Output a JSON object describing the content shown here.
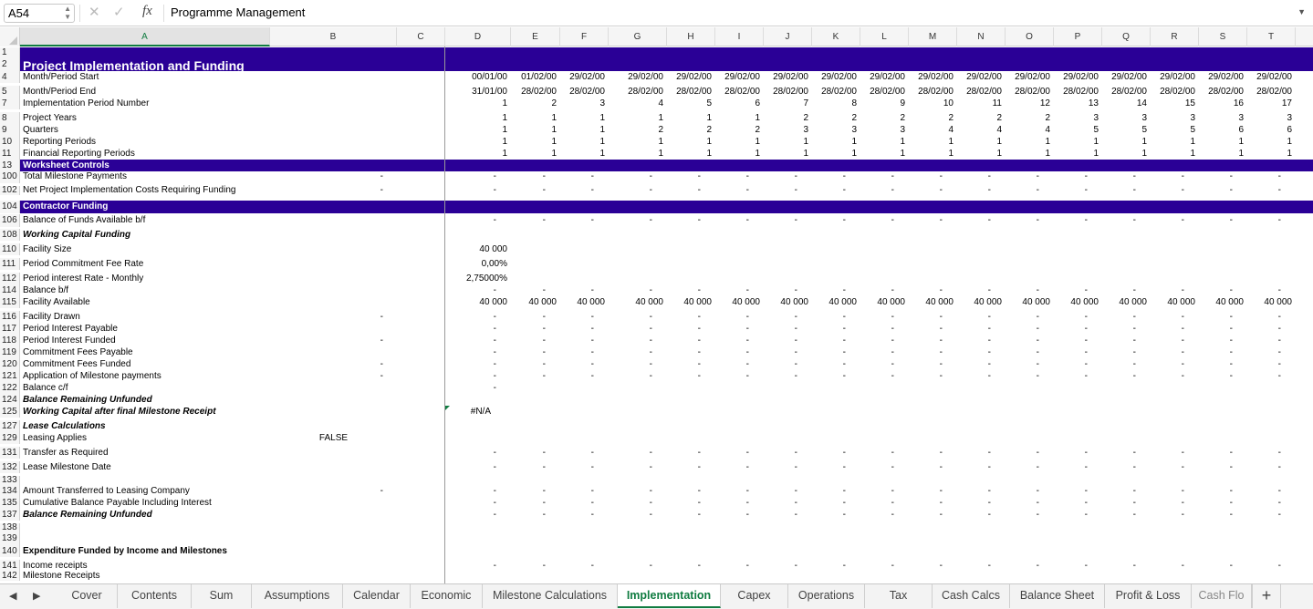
{
  "formula_bar": {
    "name_box": "A54",
    "fx_label": "fx",
    "formula": "Programme Management"
  },
  "columns": [
    "A",
    "B",
    "C",
    "D",
    "E",
    "F",
    "G",
    "H",
    "I",
    "J",
    "K",
    "L",
    "M",
    "N",
    "O",
    "P",
    "Q",
    "R",
    "S",
    "T"
  ],
  "rows": [
    {
      "n": "1",
      "type": "band",
      "label": ""
    },
    {
      "n": "2",
      "type": "band",
      "label": "Project Implementation and Funding",
      "big": true
    },
    {
      "n": "4",
      "label": "Month/Period Start",
      "vals": [
        "00/01/00",
        "01/02/00",
        "29/02/00",
        "29/02/00",
        "29/02/00",
        "29/02/00",
        "29/02/00",
        "29/02/00",
        "29/02/00",
        "29/02/00",
        "29/02/00",
        "29/02/00",
        "29/02/00",
        "29/02/00",
        "29/02/00",
        "29/02/00",
        "29/02/00"
      ]
    },
    {
      "n": "5",
      "label": "Month/Period End",
      "vals": [
        "31/01/00",
        "28/02/00",
        "28/02/00",
        "28/02/00",
        "28/02/00",
        "28/02/00",
        "28/02/00",
        "28/02/00",
        "28/02/00",
        "28/02/00",
        "28/02/00",
        "28/02/00",
        "28/02/00",
        "28/02/00",
        "28/02/00",
        "28/02/00",
        "28/02/00"
      ]
    },
    {
      "n": "7",
      "label": "Implementation Period Number",
      "vals": [
        "1",
        "2",
        "3",
        "4",
        "5",
        "6",
        "7",
        "8",
        "9",
        "10",
        "11",
        "12",
        "13",
        "14",
        "15",
        "16",
        "17"
      ]
    },
    {
      "n": "8",
      "label": "Project Years",
      "vals": [
        "1",
        "1",
        "1",
        "1",
        "1",
        "1",
        "2",
        "2",
        "2",
        "2",
        "2",
        "2",
        "3",
        "3",
        "3",
        "3",
        "3"
      ]
    },
    {
      "n": "9",
      "label": "Quarters",
      "vals": [
        "1",
        "1",
        "1",
        "2",
        "2",
        "2",
        "3",
        "3",
        "3",
        "4",
        "4",
        "4",
        "5",
        "5",
        "5",
        "6",
        "6"
      ]
    },
    {
      "n": "10",
      "label": "Reporting Periods",
      "vals": [
        "1",
        "1",
        "1",
        "1",
        "1",
        "1",
        "1",
        "1",
        "1",
        "1",
        "1",
        "1",
        "1",
        "1",
        "1",
        "1",
        "1"
      ]
    },
    {
      "n": "11",
      "label": "Financial Reporting Periods",
      "vals": [
        "1",
        "1",
        "1",
        "1",
        "1",
        "1",
        "1",
        "1",
        "1",
        "1",
        "1",
        "1",
        "1",
        "1",
        "1",
        "1",
        "1"
      ]
    },
    {
      "n": "13",
      "type": "band",
      "label": "Worksheet Controls"
    },
    {
      "n": "100",
      "label": "Total Milestone Payments",
      "b": "-",
      "dash": true
    },
    {
      "n": "102",
      "label": "Net Project Implementation Costs Requiring Funding",
      "b": "-",
      "dash": true
    },
    {
      "n": "104",
      "type": "band",
      "label": "Contractor Funding"
    },
    {
      "n": "106",
      "label": "Balance of Funds Available b/f",
      "dash": true
    },
    {
      "n": "108",
      "label": "Working Capital Funding",
      "style": "bi"
    },
    {
      "n": "110",
      "label": "Facility Size",
      "vals": [
        "40 000"
      ]
    },
    {
      "n": "111",
      "label": "Period Commitment Fee Rate",
      "vals": [
        "0,00%"
      ]
    },
    {
      "n": "112",
      "label": "Period interest Rate - Monthly",
      "vals": [
        "2,75000%"
      ]
    },
    {
      "n": "114",
      "label": "Balance b/f",
      "dash": true
    },
    {
      "n": "115",
      "label": "Facility Available",
      "vals": [
        "40 000",
        "40 000",
        "40 000",
        "40 000",
        "40 000",
        "40 000",
        "40 000",
        "40 000",
        "40 000",
        "40 000",
        "40 000",
        "40 000",
        "40 000",
        "40 000",
        "40 000",
        "40 000",
        "40 000"
      ]
    },
    {
      "n": "116",
      "label": "Facility Drawn",
      "b": "-",
      "dash": true
    },
    {
      "n": "117",
      "label": "Period Interest Payable",
      "dash": true
    },
    {
      "n": "118",
      "label": "Period Interest Funded",
      "b": "-",
      "dash": true
    },
    {
      "n": "119",
      "label": "Commitment Fees Payable",
      "dash": true
    },
    {
      "n": "120",
      "label": "Commitment Fees Funded",
      "b": "-",
      "dash": true
    },
    {
      "n": "121",
      "label": "Application of Milestone payments",
      "b": "-",
      "dash": true
    },
    {
      "n": "122",
      "label": "Balance c/f",
      "dash": true,
      "dashOnlyD": true
    },
    {
      "n": "124",
      "label": "Balance Remaining Unfunded",
      "style": "bi"
    },
    {
      "n": "125",
      "label": "Working Capital after final Milestone Receipt",
      "style": "bi",
      "dtext": "#N/A"
    },
    {
      "n": "127",
      "label": "Lease Calculations",
      "style": "bi"
    },
    {
      "n": "129",
      "label": "Leasing Applies",
      "btext": "FALSE"
    },
    {
      "n": "131",
      "label": "Transfer as Required",
      "dash": true
    },
    {
      "n": "132",
      "label": "Lease Milestone Date",
      "dash": true
    },
    {
      "n": "133",
      "label": ""
    },
    {
      "n": "134",
      "label": "Amount Transferred to Leasing Company",
      "b": "-",
      "dash": true
    },
    {
      "n": "135",
      "label": "Cumulative Balance Payable Including Interest",
      "dash": true
    },
    {
      "n": "137",
      "label": "Balance Remaining Unfunded",
      "style": "bi",
      "dash": true
    },
    {
      "n": "138",
      "label": ""
    },
    {
      "n": "139",
      "label": ""
    },
    {
      "n": "140",
      "label": "Expenditure Funded by Income and Milestones",
      "style": "b"
    },
    {
      "n": "141",
      "label": "Income receipts",
      "dash": true
    },
    {
      "n": "142",
      "label": "Milestone Receipts",
      "clip": true
    }
  ],
  "tabs": [
    "Cover",
    "Contents",
    "Sum",
    "Assumptions",
    "Calendar",
    "Economic",
    "Milestone Calculations",
    "Implementation",
    "Capex",
    "Operations",
    "Tax",
    "Cash Calcs",
    "Balance Sheet",
    "Profit & Loss",
    "Cash Flo"
  ],
  "active_tab": "Implementation",
  "colors": {
    "band": "#2a0096",
    "accent": "#107c41"
  }
}
